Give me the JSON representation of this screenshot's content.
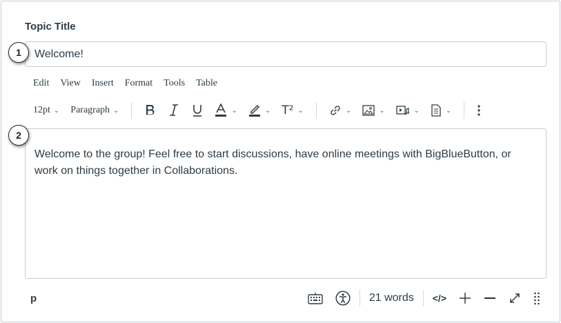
{
  "topic": {
    "label": "Topic Title",
    "value": "Welcome!"
  },
  "callouts": [
    "1",
    "2"
  ],
  "menubar": {
    "items": [
      "Edit",
      "View",
      "Insert",
      "Format",
      "Tools",
      "Table"
    ]
  },
  "toolbar": {
    "font_size": "12pt",
    "block_format": "Paragraph",
    "superscript_label": "T²",
    "icons": [
      "bold-icon",
      "italic-icon",
      "underline-icon",
      "text-color-icon",
      "highlight-icon",
      "superscript-icon",
      "link-icon",
      "image-icon",
      "media-icon",
      "document-icon",
      "more-icon"
    ]
  },
  "editor": {
    "content": "Welcome to the group! Feel free to start discussions, have online meetings with BigBlueButton, or work on things together in Collaborations."
  },
  "statusbar": {
    "path": "p",
    "word_count": "21 words",
    "code_label": "</>"
  }
}
